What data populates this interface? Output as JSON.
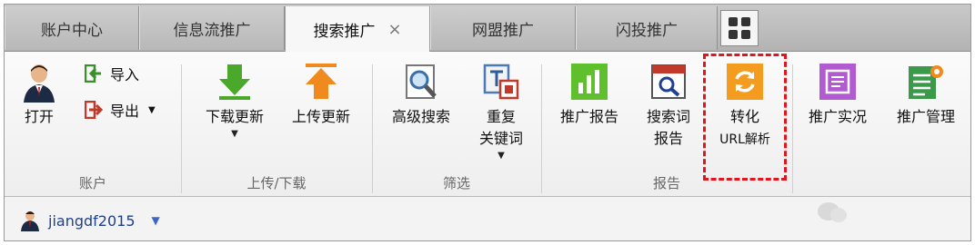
{
  "tabs": [
    {
      "label": "账户中心"
    },
    {
      "label": "信息流推广"
    },
    {
      "label": "搜索推广",
      "active": true,
      "close": "×"
    },
    {
      "label": "网盟推广"
    },
    {
      "label": "闪投推广"
    }
  ],
  "apps_icon": "grid-icon",
  "account": {
    "open_label": "打开",
    "import_label": "导入",
    "export_label": "导出",
    "group_label": "账户"
  },
  "transfer": {
    "download_label": "下载更新",
    "upload_label": "上传更新",
    "group_label": "上传/下载"
  },
  "filter": {
    "advanced_search_label": "高级搜索",
    "dup_keywords_line1": "重复",
    "dup_keywords_line2": "关键词",
    "group_label": "筛选"
  },
  "reports": {
    "promo_report_label": "推广报告",
    "search_term_line1": "搜索词",
    "search_term_line2": "报告",
    "convert_line1": "转化",
    "convert_line2": "URL解析",
    "group_label": "报告"
  },
  "extras": {
    "live_label": "推广实况",
    "manage_label": "推广管理"
  },
  "user": {
    "name": "jiangdf2015"
  },
  "colors": {
    "highlight": "#e0161e",
    "green": "#4aa82a",
    "orange": "#f08a1e",
    "purple": "#a64fc7",
    "link": "#1f3f8f"
  }
}
